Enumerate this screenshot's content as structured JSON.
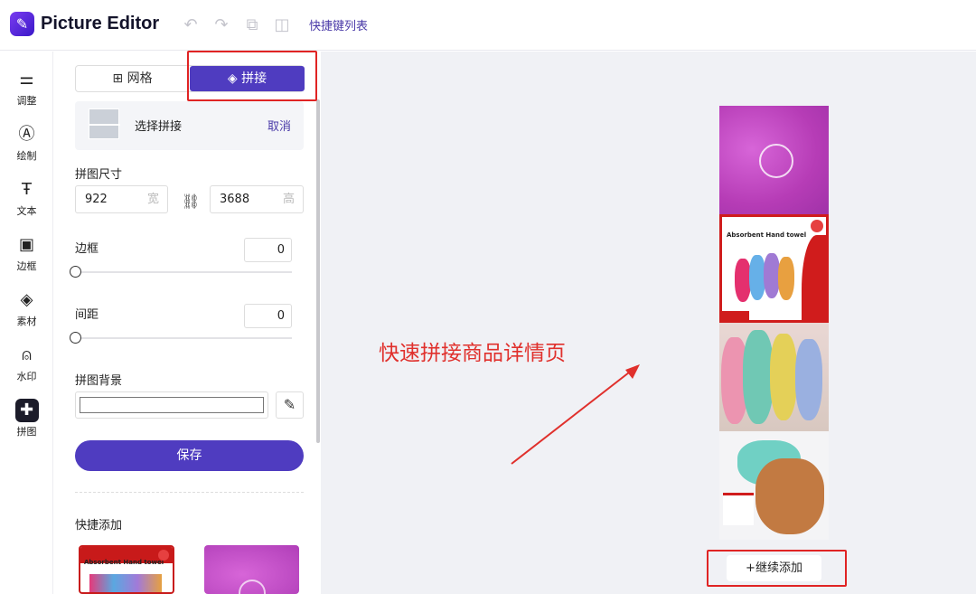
{
  "app": {
    "title": "Picture Editor",
    "shortcut_link": "快捷键列表"
  },
  "toolbar": {
    "icons": [
      "undo-icon",
      "redo-icon",
      "crop-compare-icon",
      "split-view-icon"
    ]
  },
  "nav": [
    {
      "label": "调整",
      "icon": "sliders-icon"
    },
    {
      "label": "绘制",
      "icon": "pen-icon"
    },
    {
      "label": "文本",
      "icon": "text-icon"
    },
    {
      "label": "边框",
      "icon": "border-icon"
    },
    {
      "label": "素材",
      "icon": "shapes-icon"
    },
    {
      "label": "水印",
      "icon": "watermark-icon"
    },
    {
      "label": "拼图",
      "icon": "puzzle-icon",
      "active": true
    }
  ],
  "panel": {
    "tabs": {
      "grid": "网格",
      "splice": "拼接",
      "active": "splice"
    },
    "selection": {
      "label": "选择拼接",
      "cancel": "取消"
    },
    "size": {
      "label": "拼图尺寸",
      "width": "922",
      "width_unit": "宽",
      "height": "3688",
      "height_unit": "高"
    },
    "border": {
      "label": "边框",
      "value": "0"
    },
    "spacing": {
      "label": "间距",
      "value": "0"
    },
    "background": {
      "label": "拼图背景",
      "color": "#ffffff"
    },
    "save": "保存",
    "quick_add": {
      "label": "快捷添加",
      "card1_title": "Absorbent Hand towel"
    }
  },
  "canvas": {
    "annotation": "快速拼接商品详情页",
    "tile2_title": "Absorbent Hand towel",
    "add_more": "+继续添加"
  },
  "colors": {
    "accent": "#4f3cc0",
    "highlight": "#e02424"
  }
}
